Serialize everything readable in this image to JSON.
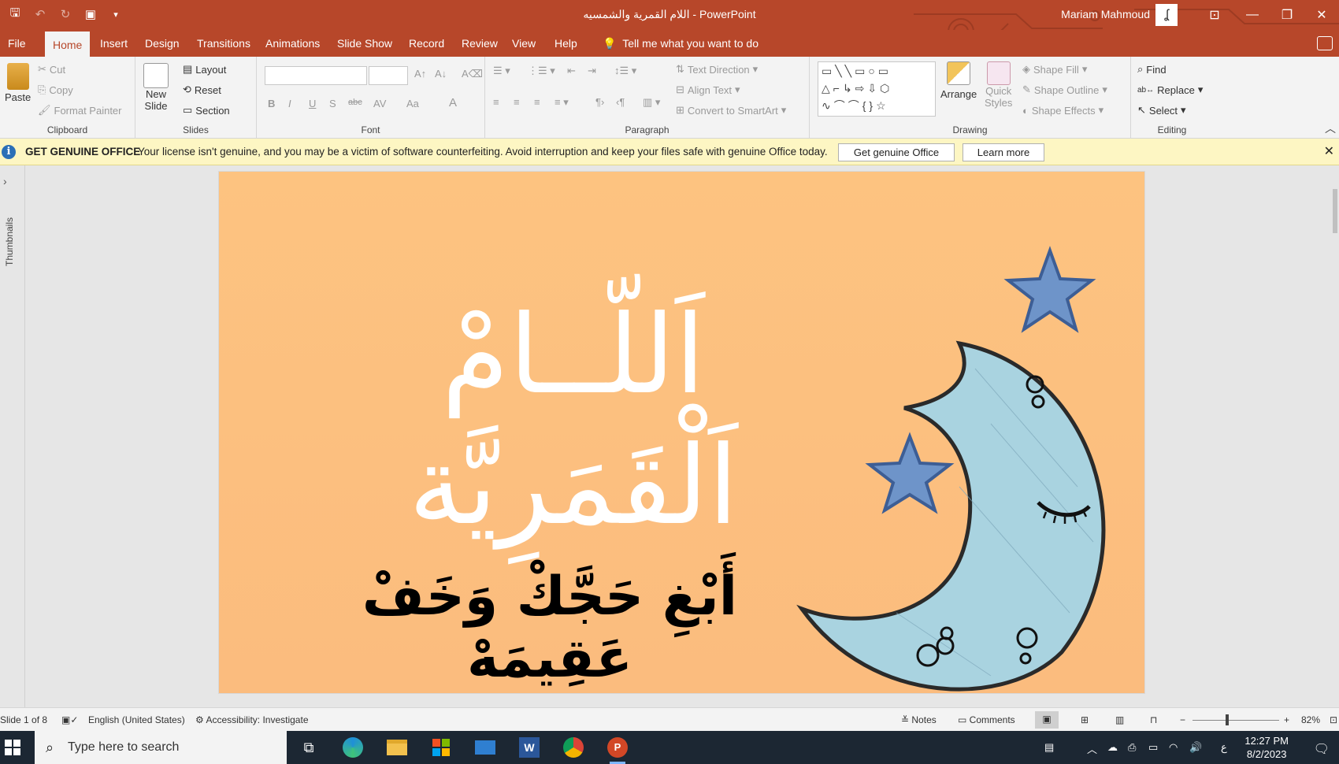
{
  "window": {
    "title": "اللام القمرية والشمسيه  -  PowerPoint",
    "user": "Mariam Mahmoud",
    "avatar_glyph": "ʆ"
  },
  "menu": {
    "tabs": [
      "File",
      "Home",
      "Insert",
      "Design",
      "Transitions",
      "Animations",
      "Slide Show",
      "Record",
      "Review",
      "View",
      "Help"
    ],
    "active_tab": "Home",
    "tell_me": "Tell me what you want to do"
  },
  "ribbon": {
    "clipboard": {
      "paste": "Paste",
      "cut": "Cut",
      "copy": "Copy",
      "format_painter": "Format Painter",
      "label": "Clipboard"
    },
    "slides": {
      "new_slide": "New",
      "new_slide2": "Slide",
      "layout": "Layout",
      "reset": "Reset",
      "section": "Section",
      "label": "Slides"
    },
    "font": {
      "label": "Font",
      "bold": "B",
      "italic": "I",
      "underline": "U",
      "shadow": "S",
      "strike": "abc",
      "spacing": "AV",
      "case": "Aa",
      "color": "A"
    },
    "paragraph": {
      "text_direction": "Text Direction",
      "align_text": "Align Text",
      "smartart": "Convert to SmartArt",
      "label": "Paragraph"
    },
    "drawing": {
      "arrange": "Arrange",
      "quick_styles": "Quick",
      "quick_styles2": "Styles",
      "shape_fill": "Shape Fill",
      "shape_outline": "Shape Outline",
      "shape_effects": "Shape Effects",
      "label": "Drawing"
    },
    "editing": {
      "find": "Find",
      "replace": "Replace",
      "select": "Select",
      "label": "Editing"
    }
  },
  "notification": {
    "heading": "GET GENUINE OFFICE",
    "message": "Your license isn't genuine, and you may be a victim of software counterfeiting. Avoid interruption and keep your files safe with genuine Office today.",
    "primary_button": "Get genuine Office",
    "secondary_button": "Learn more"
  },
  "sidebar": {
    "label": "Thumbnails"
  },
  "slide": {
    "title": "اَللّــامْ اَلْقَمَرِيَّة",
    "subtitle": "أَبْغِ حَجَّكْ وَخَفْ عَقِيمَهْ",
    "colors": {
      "background": "#fcbf80",
      "moon": "#a9d3e0",
      "star": "#6e94c9"
    }
  },
  "status": {
    "slide_counter": "Slide 1 of 8",
    "language": "English (United States)",
    "accessibility": "Accessibility: Investigate",
    "notes": "Notes",
    "comments": "Comments",
    "zoom": "82%"
  },
  "taskbar": {
    "search_placeholder": "Type here to search",
    "time": "12:27 PM",
    "date": "8/2/2023",
    "input_lang": "ع"
  }
}
